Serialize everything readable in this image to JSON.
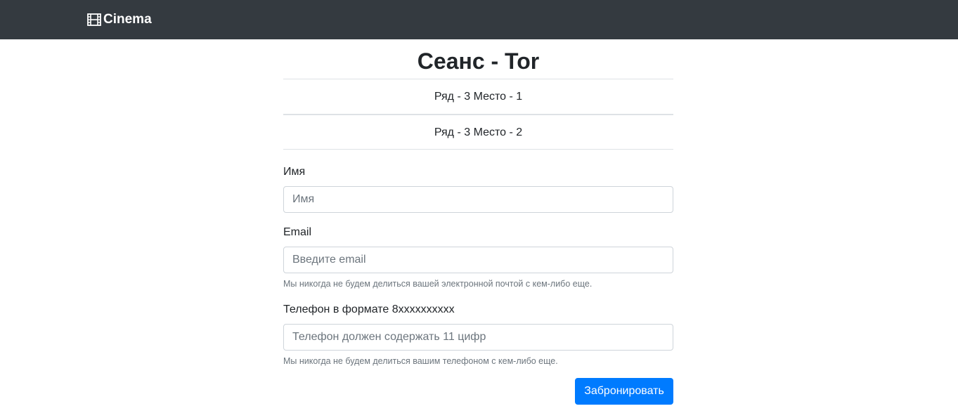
{
  "navbar": {
    "brand_icon": "film-icon",
    "brand_label": "Cinema",
    "background": "#343a40"
  },
  "page": {
    "title": "Сеанс - Tor"
  },
  "seats": [
    {
      "label": "Ряд - 3 Место - 1"
    },
    {
      "label": "Ряд - 3 Место - 2"
    }
  ],
  "form": {
    "name": {
      "label": "Имя",
      "placeholder": "Имя",
      "value": ""
    },
    "email": {
      "label": "Email",
      "placeholder": "Введите email",
      "value": "",
      "help": "Мы никогда не будем делиться вашей электронной почтой с кем-либо еще."
    },
    "phone": {
      "label": "Телефон в формате 8xxxxxxxxxx",
      "placeholder": "Телефон должен содержать 11 цифр",
      "value": "",
      "help": "Мы никогда не будем делиться вашим телефоном с кем-либо еще."
    },
    "submit_label": "Забронировать",
    "accent": "#007bff"
  }
}
